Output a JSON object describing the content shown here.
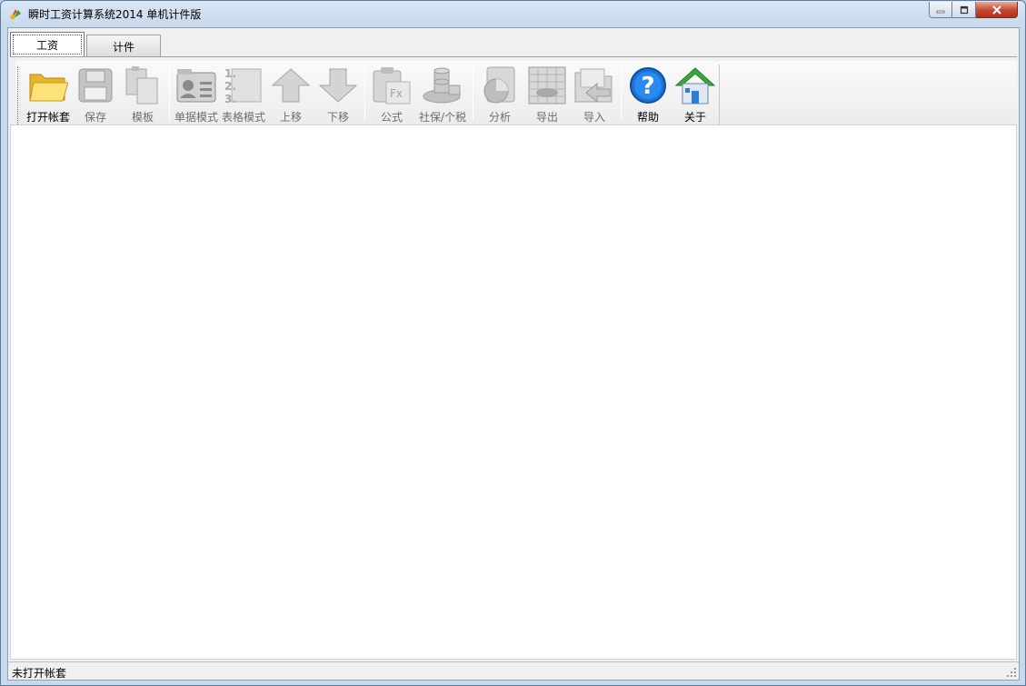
{
  "window": {
    "title": "瞬时工资计算系统2014 单机计件版"
  },
  "tabs": [
    {
      "label": "工资",
      "active": true
    },
    {
      "label": "计件",
      "active": false
    }
  ],
  "toolbar": {
    "open_account": "打开帐套",
    "save": "保存",
    "template": "模板",
    "single_mode": "单据模式",
    "table_mode": "表格模式",
    "move_up": "上移",
    "move_down": "下移",
    "formula": "公式",
    "social_tax": "社保/个税",
    "analyze": "分析",
    "export": "导出",
    "import": "导入",
    "help": "帮助",
    "about": "关于"
  },
  "icons": {
    "open_account": "folder-icon",
    "save": "floppy-disk-icon",
    "template": "copy-documents-icon",
    "single_mode": "id-card-icon",
    "table_mode": "numbered-list-icon",
    "move_up": "arrow-up-icon",
    "move_down": "arrow-down-icon",
    "formula": "clipboard-fx-icon",
    "social_tax": "coin-stack-icon",
    "analyze": "pie-chart-icon",
    "export": "spreadsheet-icon",
    "import": "folder-import-icon",
    "help": "question-mark-icon",
    "about": "house-icon"
  },
  "status": {
    "text": "未打开帐套"
  },
  "colors": {
    "title_bar": "#c8d9ec",
    "close_button": "#c6452f",
    "help_blue": "#1a74d6",
    "about_green": "#3aa83a",
    "folder_yellow": "#f5c842",
    "disabled_gray": "#b8b8b8"
  }
}
